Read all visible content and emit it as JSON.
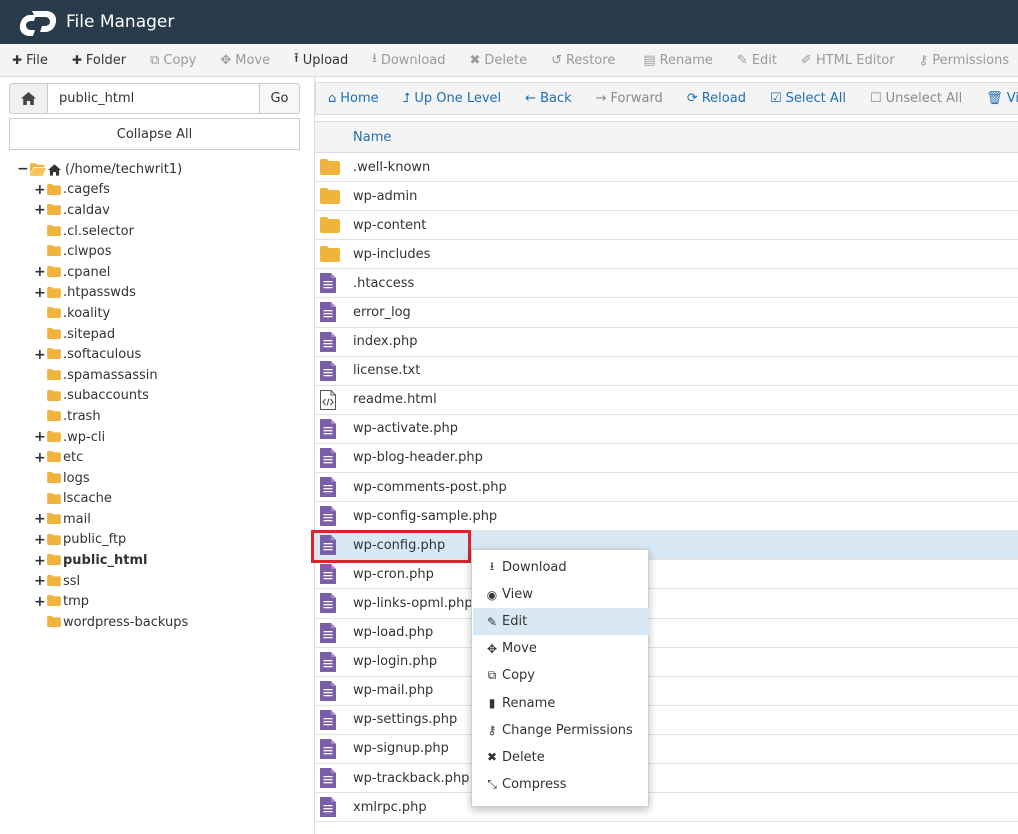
{
  "app": {
    "title": "File Manager"
  },
  "toolbar": [
    {
      "label": "File",
      "icon": "plus-icon",
      "glyph": "✚",
      "disabled": false
    },
    {
      "label": "Folder",
      "icon": "plus-icon",
      "glyph": "✚",
      "disabled": false
    },
    {
      "label": "Copy",
      "icon": "copy-icon",
      "glyph": "⧉",
      "disabled": true
    },
    {
      "label": "Move",
      "icon": "move-icon",
      "glyph": "✥",
      "disabled": true
    },
    {
      "label": "Upload",
      "icon": "upload-icon",
      "glyph": "⭱",
      "disabled": false
    },
    {
      "label": "Download",
      "icon": "download-icon",
      "glyph": "⭳",
      "disabled": true
    },
    {
      "label": "Delete",
      "icon": "delete-icon",
      "glyph": "✖",
      "disabled": true
    },
    {
      "label": "Restore",
      "icon": "restore-icon",
      "glyph": "↺",
      "disabled": true
    },
    {
      "label": "Rename",
      "icon": "file-icon",
      "glyph": "▤",
      "disabled": true
    },
    {
      "label": "Edit",
      "icon": "pencil-icon",
      "glyph": "✎",
      "disabled": true
    },
    {
      "label": "HTML Editor",
      "icon": "html-editor-icon",
      "glyph": "✐",
      "disabled": true
    },
    {
      "label": "Permissions",
      "icon": "key-icon",
      "glyph": "⚷",
      "disabled": true
    }
  ],
  "path": {
    "value": "public_html",
    "go_label": "Go",
    "collapse_label": "Collapse All"
  },
  "tree": [
    {
      "label": "(/home/techwrit1)",
      "level": 0,
      "toggle": "−",
      "open": true,
      "home": true,
      "bold": false
    },
    {
      "label": ".cagefs",
      "level": 1,
      "toggle": "+",
      "bold": false
    },
    {
      "label": ".caldav",
      "level": 1,
      "toggle": "+",
      "bold": false
    },
    {
      "label": ".cl.selector",
      "level": 1,
      "toggle": "",
      "bold": false
    },
    {
      "label": ".clwpos",
      "level": 1,
      "toggle": "",
      "bold": false
    },
    {
      "label": ".cpanel",
      "level": 1,
      "toggle": "+",
      "bold": false
    },
    {
      "label": ".htpasswds",
      "level": 1,
      "toggle": "+",
      "bold": false
    },
    {
      "label": ".koality",
      "level": 1,
      "toggle": "",
      "bold": false
    },
    {
      "label": ".sitepad",
      "level": 1,
      "toggle": "",
      "bold": false
    },
    {
      "label": ".softaculous",
      "level": 1,
      "toggle": "+",
      "bold": false
    },
    {
      "label": ".spamassassin",
      "level": 1,
      "toggle": "",
      "bold": false
    },
    {
      "label": ".subaccounts",
      "level": 1,
      "toggle": "",
      "bold": false
    },
    {
      "label": ".trash",
      "level": 1,
      "toggle": "",
      "bold": false
    },
    {
      "label": ".wp-cli",
      "level": 1,
      "toggle": "+",
      "bold": false
    },
    {
      "label": "etc",
      "level": 1,
      "toggle": "+",
      "bold": false
    },
    {
      "label": "logs",
      "level": 1,
      "toggle": "",
      "bold": false
    },
    {
      "label": "lscache",
      "level": 1,
      "toggle": "",
      "bold": false
    },
    {
      "label": "mail",
      "level": 1,
      "toggle": "+",
      "bold": false
    },
    {
      "label": "public_ftp",
      "level": 1,
      "toggle": "+",
      "bold": false
    },
    {
      "label": "public_html",
      "level": 1,
      "toggle": "+",
      "bold": true
    },
    {
      "label": "ssl",
      "level": 1,
      "toggle": "+",
      "bold": false
    },
    {
      "label": "tmp",
      "level": 1,
      "toggle": "+",
      "bold": false
    },
    {
      "label": "wordpress-backups",
      "level": 1,
      "toggle": "",
      "bold": false
    }
  ],
  "nav": [
    {
      "label": "Home",
      "icon": "home-icon",
      "glyph": "⌂",
      "disabled": false
    },
    {
      "label": "Up One Level",
      "icon": "level-up-icon",
      "glyph": "⮥",
      "disabled": false
    },
    {
      "label": "Back",
      "icon": "arrow-left-icon",
      "glyph": "←",
      "disabled": false
    },
    {
      "label": "Forward",
      "icon": "arrow-right-icon",
      "glyph": "→",
      "disabled": true
    },
    {
      "label": "Reload",
      "icon": "reload-icon",
      "glyph": "⟳",
      "disabled": false
    },
    {
      "label": "Select All",
      "icon": "checkbox-checked-icon",
      "glyph": "☑",
      "disabled": false
    },
    {
      "label": "Unselect All",
      "icon": "checkbox-empty-icon",
      "glyph": "☐",
      "disabled": true
    },
    {
      "label": "View",
      "icon": "trash-icon",
      "glyph": "🗑",
      "disabled": false
    }
  ],
  "filelist": {
    "column_name": "Name",
    "files": [
      {
        "name": ".well-known",
        "type": "folder"
      },
      {
        "name": "wp-admin",
        "type": "folder"
      },
      {
        "name": "wp-content",
        "type": "folder"
      },
      {
        "name": "wp-includes",
        "type": "folder"
      },
      {
        "name": ".htaccess",
        "type": "text"
      },
      {
        "name": "error_log",
        "type": "text"
      },
      {
        "name": "index.php",
        "type": "text"
      },
      {
        "name": "license.txt",
        "type": "text"
      },
      {
        "name": "readme.html",
        "type": "html"
      },
      {
        "name": "wp-activate.php",
        "type": "text"
      },
      {
        "name": "wp-blog-header.php",
        "type": "text"
      },
      {
        "name": "wp-comments-post.php",
        "type": "text"
      },
      {
        "name": "wp-config-sample.php",
        "type": "text"
      },
      {
        "name": "wp-config.php",
        "type": "text",
        "selected": true
      },
      {
        "name": "wp-cron.php",
        "type": "text"
      },
      {
        "name": "wp-links-opml.php",
        "type": "text"
      },
      {
        "name": "wp-load.php",
        "type": "text"
      },
      {
        "name": "wp-login.php",
        "type": "text"
      },
      {
        "name": "wp-mail.php",
        "type": "text"
      },
      {
        "name": "wp-settings.php",
        "type": "text"
      },
      {
        "name": "wp-signup.php",
        "type": "text"
      },
      {
        "name": "wp-trackback.php",
        "type": "text"
      },
      {
        "name": "xmlrpc.php",
        "type": "text"
      }
    ]
  },
  "context_menu": [
    {
      "label": "Download",
      "icon": "download-icon",
      "glyph": "⭳",
      "hover": false
    },
    {
      "label": "View",
      "icon": "eye-icon",
      "glyph": "◉",
      "hover": false
    },
    {
      "label": "Edit",
      "icon": "pencil-icon",
      "glyph": "✎",
      "hover": true
    },
    {
      "label": "Move",
      "icon": "move-icon",
      "glyph": "✥",
      "hover": false
    },
    {
      "label": "Copy",
      "icon": "copy-icon",
      "glyph": "⧉",
      "hover": false
    },
    {
      "label": "Rename",
      "icon": "file-icon",
      "glyph": "▮",
      "hover": false
    },
    {
      "label": "Change Permissions",
      "icon": "key-icon",
      "glyph": "⚷",
      "hover": false
    },
    {
      "label": "Delete",
      "icon": "delete-icon",
      "glyph": "✖",
      "hover": false
    },
    {
      "label": "Compress",
      "icon": "compress-icon",
      "glyph": "⤡",
      "hover": false
    }
  ],
  "colors": {
    "header_bg": "#293a4a",
    "folder": "#f0b43c",
    "file": "#7a5ea8",
    "link": "#1c6fb8",
    "selected_row": "#d9e8f5",
    "highlight": "#d9252b"
  }
}
